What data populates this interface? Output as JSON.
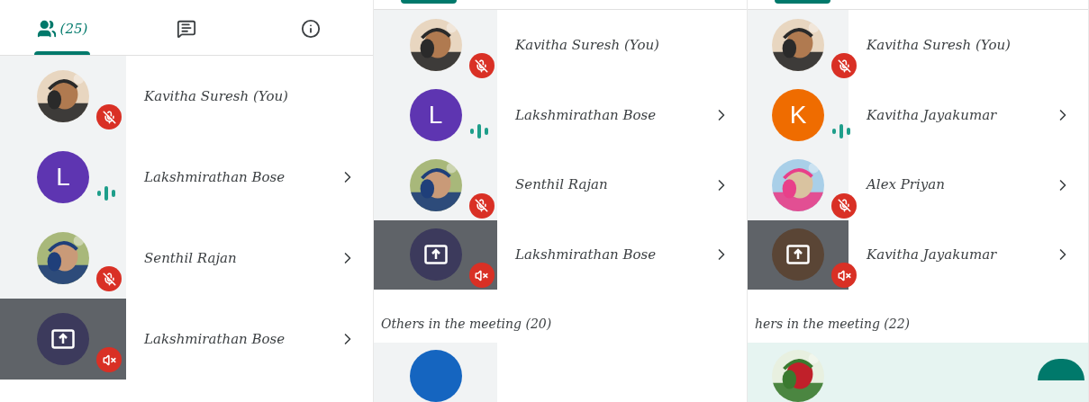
{
  "panels": [
    {
      "tabs_cropped": false,
      "tabs": [
        {
          "kind": "people",
          "label": "(25)",
          "selected": true
        },
        {
          "kind": "chat",
          "selected": false
        },
        {
          "kind": "info",
          "selected": false
        }
      ],
      "participants": [
        {
          "name": "Kavitha Suresh (You)",
          "indicator": {
            "kind": "mic_off"
          },
          "chevron": false
        },
        {
          "name": "Lakshmirathan Bose",
          "avatar": {
            "kind": "letter",
            "letter": "L",
            "color": "#5e35b1"
          },
          "indicator": {
            "kind": "speaking"
          },
          "chevron": true
        },
        {
          "name": "Senthil Rajan",
          "indicator": {
            "kind": "mic_off"
          },
          "chevron": true
        },
        {
          "name": "Lakshmirathan Bose",
          "avatar": {
            "kind": "screen",
            "color": "#3c3a5c"
          },
          "indicator": {
            "kind": "volume_off"
          },
          "chevron": true
        }
      ]
    },
    {
      "tabs_cropped": true,
      "tabs": [
        {
          "kind": "people",
          "selected": true
        }
      ],
      "participants": [
        {
          "name": "Kavitha Suresh (You)",
          "indicator": {
            "kind": "mic_off"
          },
          "chevron": false
        },
        {
          "name": "Lakshmirathan Bose",
          "avatar": {
            "kind": "letter",
            "letter": "L",
            "color": "#5e35b1"
          },
          "indicator": {
            "kind": "speaking"
          },
          "chevron": true
        },
        {
          "name": "Senthil Rajan",
          "indicator": {
            "kind": "mic_off"
          },
          "chevron": true
        },
        {
          "name": "Lakshmirathan Bose",
          "avatar": {
            "kind": "screen",
            "color": "#3c3a5c"
          },
          "indicator": {
            "kind": "volume_off"
          },
          "chevron": true
        }
      ],
      "others_header": "Others in the meeting (20)",
      "partial_row": {
        "avatar": {
          "kind": "letter",
          "color": "#1565c0"
        },
        "button": false
      }
    },
    {
      "tabs_cropped": true,
      "tabs": [
        {
          "kind": "people",
          "selected": true
        }
      ],
      "participants": [
        {
          "name": "Kavitha Suresh (You)",
          "indicator": {
            "kind": "mic_off"
          },
          "chevron": false
        },
        {
          "name": "Kavitha Jayakumar",
          "avatar": {
            "kind": "letter",
            "letter": "K",
            "color": "#ef6c00"
          },
          "indicator": {
            "kind": "speaking"
          },
          "chevron": true
        },
        {
          "name": "Alex Priyan",
          "indicator": {
            "kind": "mic_off"
          },
          "chevron": true
        },
        {
          "name": "Kavitha Jayakumar",
          "avatar": {
            "kind": "screen",
            "color": "#5a4535"
          },
          "indicator": {
            "kind": "volume_off"
          },
          "chevron": true
        }
      ],
      "others_header": "hers in the meeting (22)",
      "partial_row": {
        "button": true
      }
    }
  ]
}
